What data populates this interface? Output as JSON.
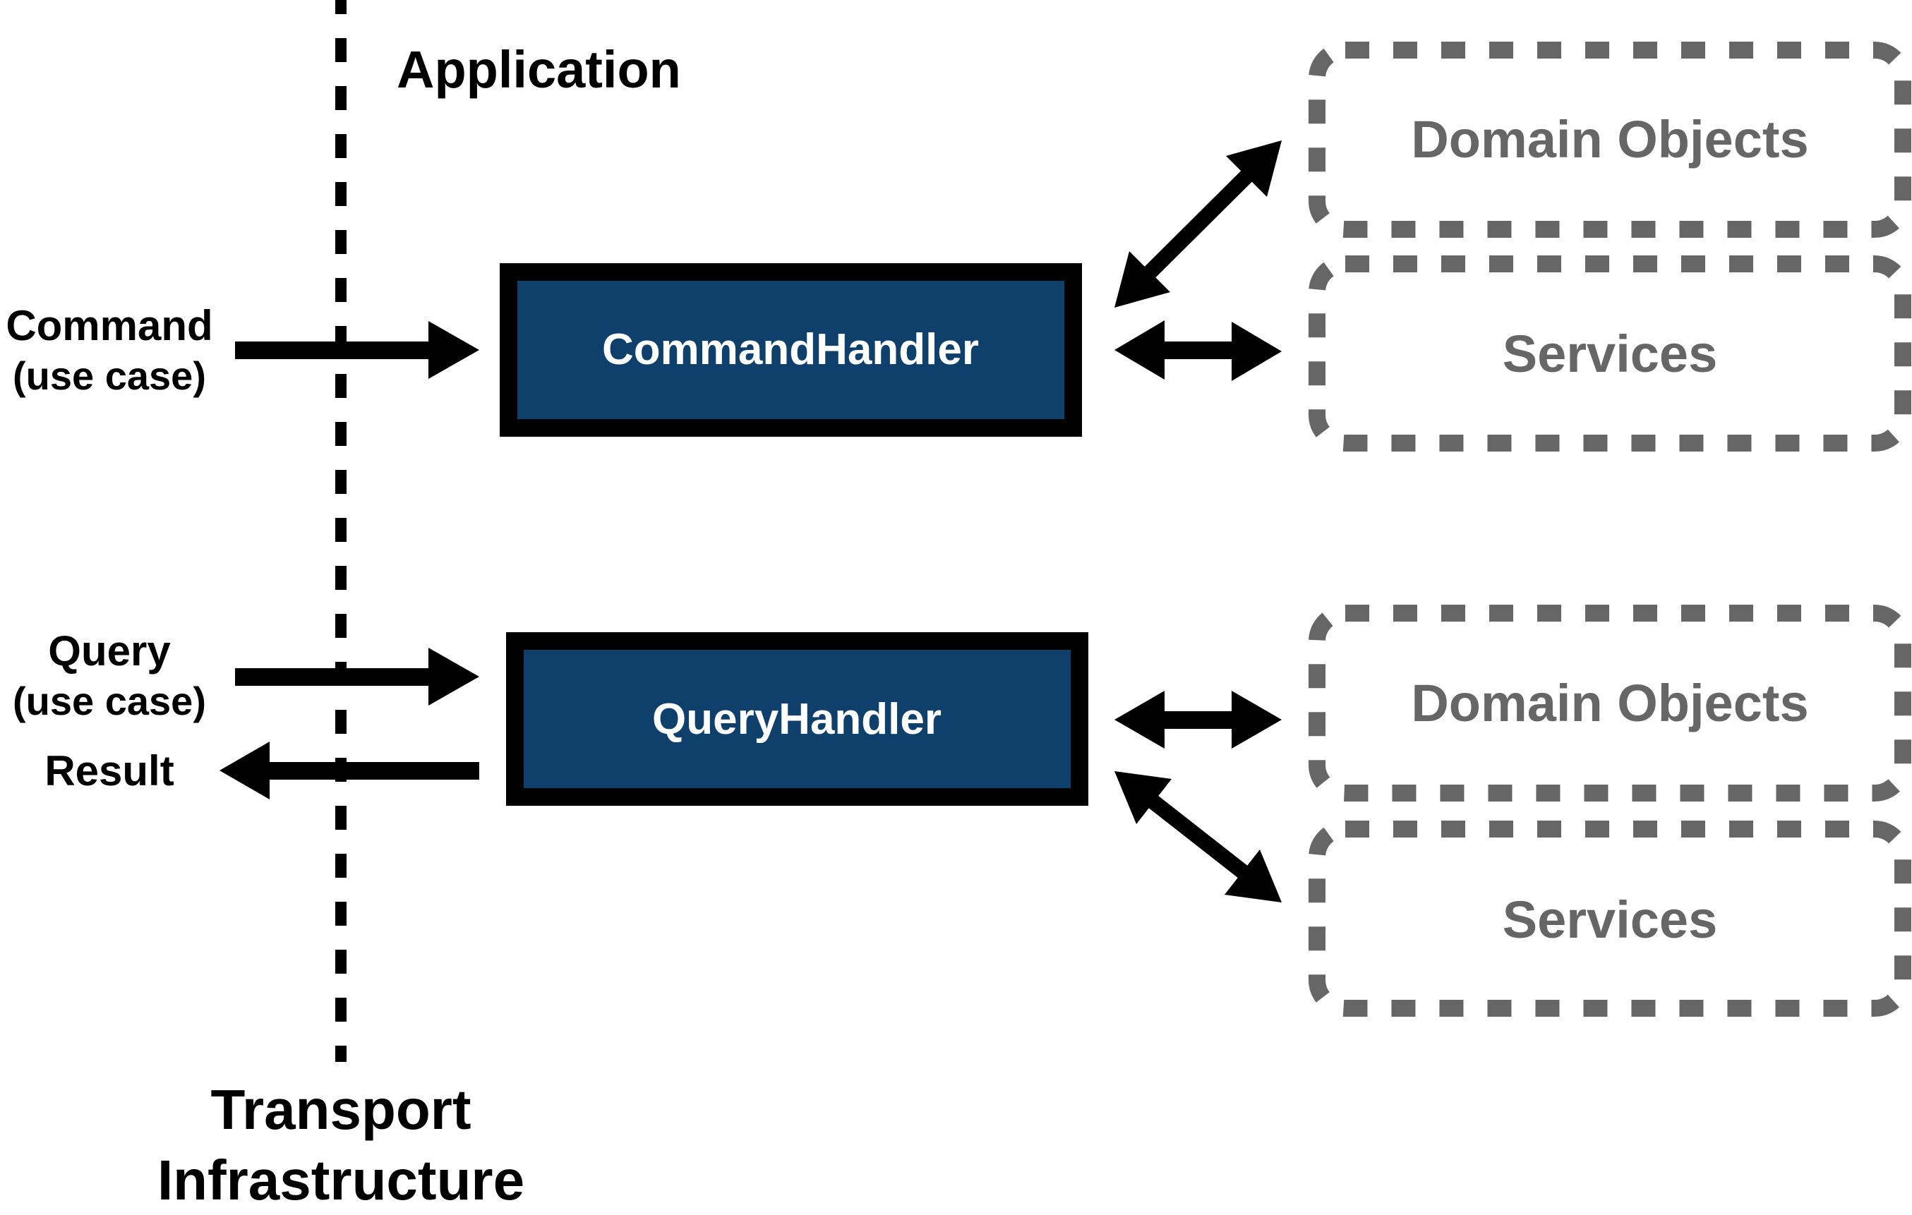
{
  "colors": {
    "handler_fill": "#0f3f6b",
    "handler_border": "#000000",
    "dependency_border": "#666666",
    "dependency_text": "#666666",
    "arrow": "#000000",
    "boundary_line": "#000000"
  },
  "layers": {
    "application_label": "Application",
    "transport_label_line1": "Transport",
    "transport_label_line2": "Infrastructure"
  },
  "inputs": {
    "command": {
      "label": "Command",
      "sublabel": "(use case)"
    },
    "query": {
      "label": "Query",
      "sublabel": "(use case)"
    },
    "result": {
      "label": "Result"
    }
  },
  "handlers": {
    "command_handler": {
      "label": "CommandHandler"
    },
    "query_handler": {
      "label": "QueryHandler"
    }
  },
  "dependencies": {
    "command_domain_objects": {
      "label": "Domain Objects"
    },
    "command_services": {
      "label": "Services"
    },
    "query_domain_objects": {
      "label": "Domain Objects"
    },
    "query_services": {
      "label": "Services"
    }
  },
  "edges": [
    {
      "from": "Command",
      "to": "CommandHandler",
      "direction": "forward"
    },
    {
      "from": "CommandHandler",
      "to": "Domain Objects",
      "direction": "both"
    },
    {
      "from": "CommandHandler",
      "to": "Services",
      "direction": "both"
    },
    {
      "from": "Query",
      "to": "QueryHandler",
      "direction": "forward"
    },
    {
      "from": "QueryHandler",
      "to": "Result",
      "direction": "forward"
    },
    {
      "from": "QueryHandler",
      "to": "Domain Objects",
      "direction": "both"
    },
    {
      "from": "QueryHandler",
      "to": "Services",
      "direction": "both"
    }
  ]
}
